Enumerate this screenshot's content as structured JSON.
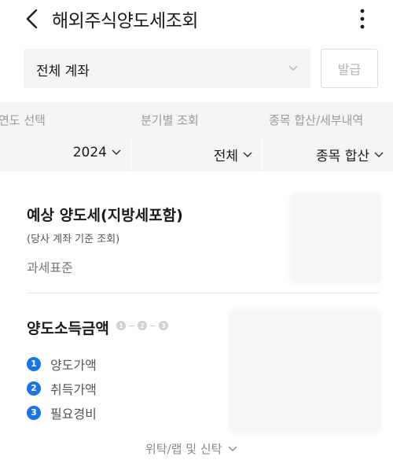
{
  "header": {
    "title": "해외주식양도세조회",
    "back_icon": "chevron-left-icon",
    "more_icon": "more-vertical-icon"
  },
  "account": {
    "selected": "전체 계좌",
    "issue_label": "발급"
  },
  "filters": [
    {
      "label": "연도 선택",
      "value": "2024"
    },
    {
      "label": "분기별 조회",
      "value": "전체"
    },
    {
      "label": "종목 합산/세부내역",
      "value": "종목 합산"
    }
  ],
  "estimate": {
    "title": "예상 양도세(지방세포함)",
    "note": "(당사 계좌 기준 조회)",
    "tax_base_label": "과세표준"
  },
  "gain": {
    "title": "양도소득금액",
    "steps": [
      "1",
      "2",
      "3"
    ],
    "items": [
      {
        "num": "1",
        "label": "양도가액"
      },
      {
        "num": "2",
        "label": "취득가액"
      },
      {
        "num": "3",
        "label": "필요경비"
      }
    ]
  },
  "expand": {
    "label": "위탁/랩 및 신탁"
  },
  "colors": {
    "accent": "#1a73e8",
    "filter_bg": "#f4f4f4",
    "muted_text": "#9a9a9a"
  }
}
